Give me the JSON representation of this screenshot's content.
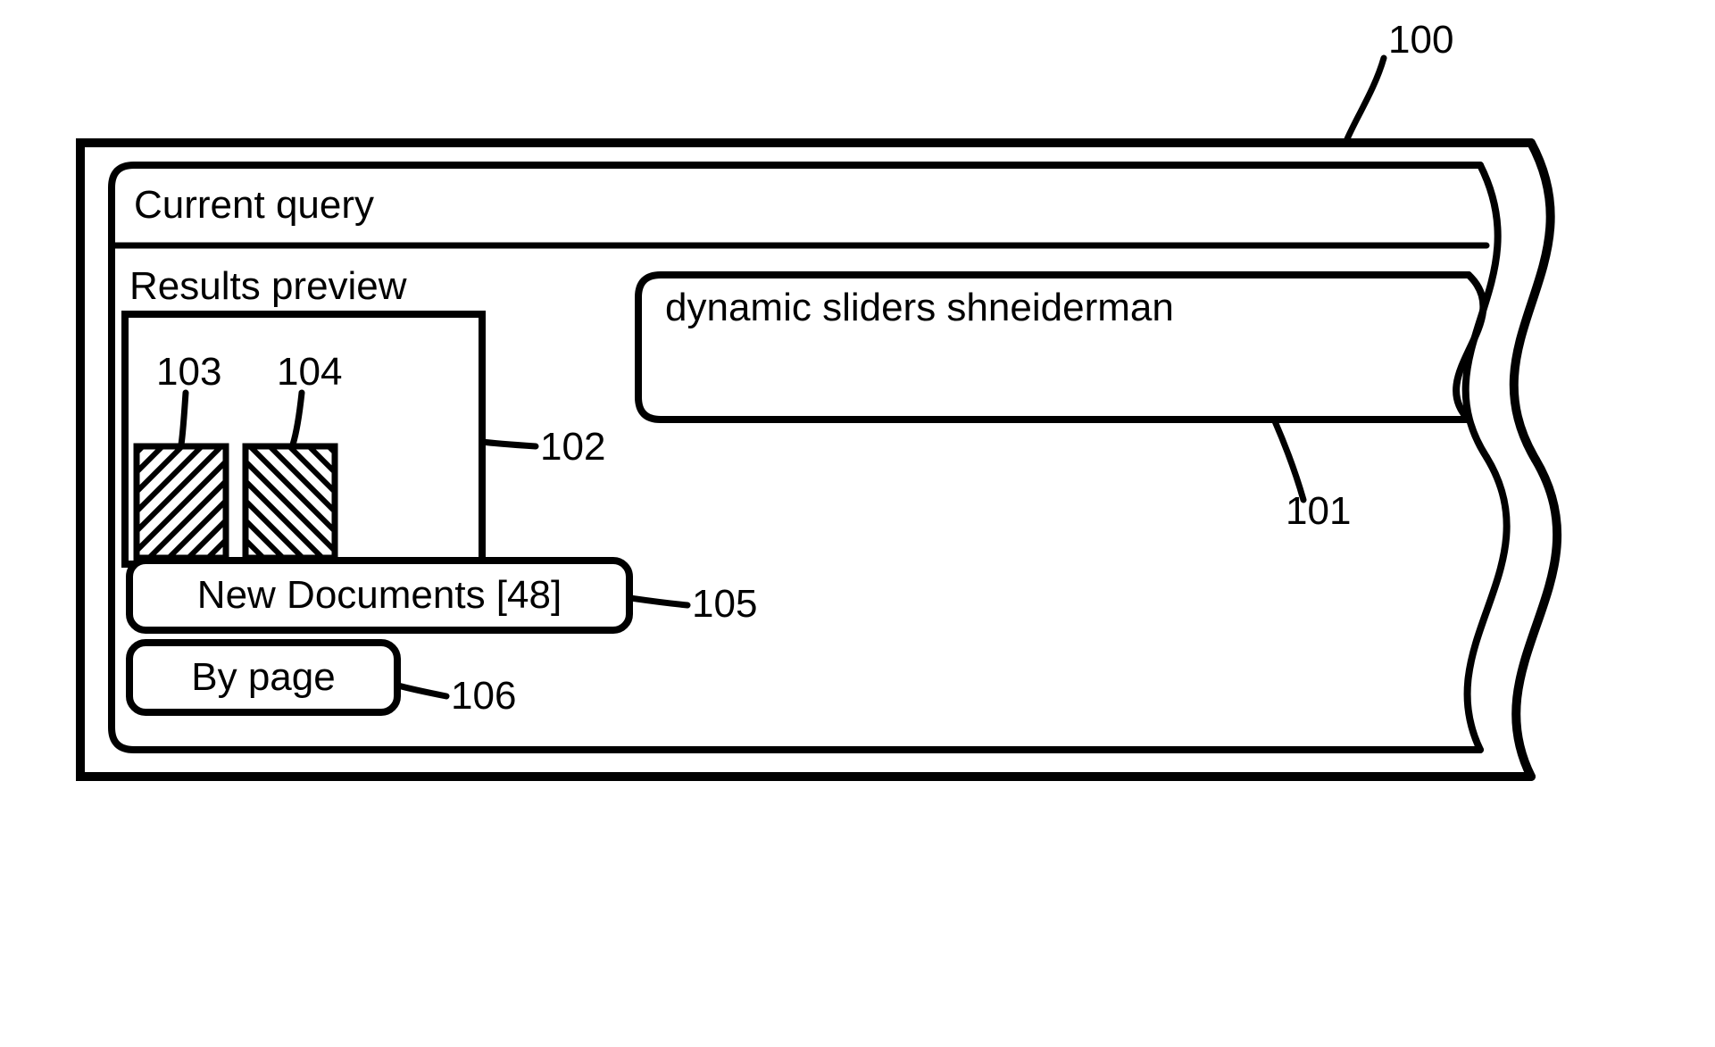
{
  "header": {
    "title": "Current query"
  },
  "preview": {
    "title": "Results preview"
  },
  "query_box": {
    "text": "dynamic sliders shneiderman"
  },
  "buttons": {
    "new_docs": "New Documents [48]",
    "by_page": "By page"
  },
  "refs": {
    "outer": "100",
    "query": "101",
    "preview": "102",
    "bar_left": "103",
    "bar_right": "104",
    "btn_newdocs": "105",
    "btn_bypage": "106"
  }
}
